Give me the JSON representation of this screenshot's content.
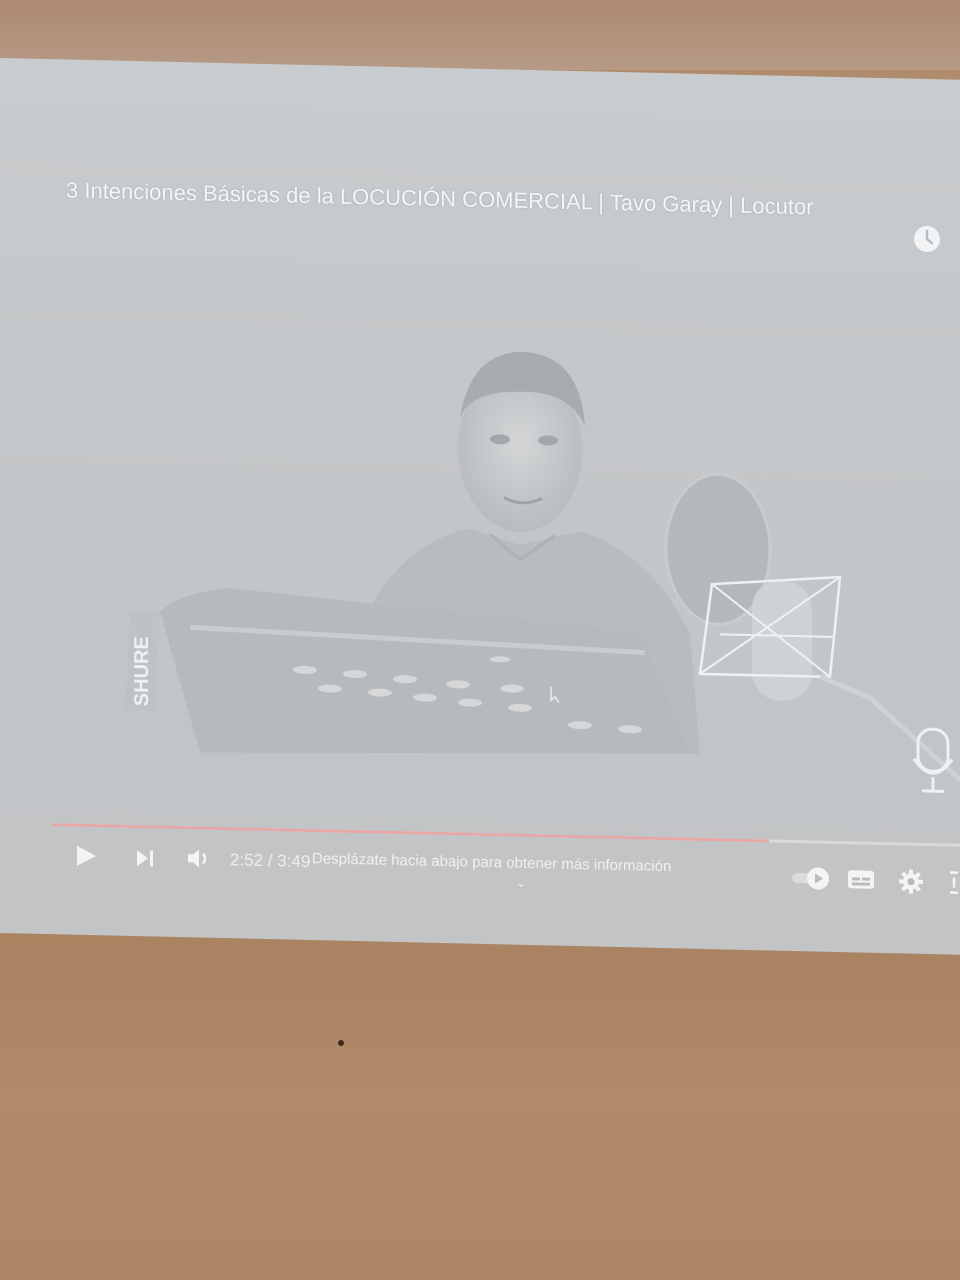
{
  "video": {
    "title": "3 Intenciones Básicas de la LOCUCIÓN COMERCIAL | Tavo Garay | Locutor",
    "watch_later_icon": "clock-icon",
    "mic_brand": "SHURE"
  },
  "player": {
    "time_display": "2:52 / 3:49",
    "progress_fraction": 0.79,
    "scroll_hint": "Desplázate hacia abajo para obtener más información",
    "icons": [
      "play-icon",
      "next-icon",
      "volume-icon",
      "autoplay-toggle-icon",
      "subtitles-icon",
      "settings-icon",
      "fullscreen-icon"
    ]
  },
  "colors": {
    "screen_bg": "#c6c9cb",
    "wall": "#b08a6a",
    "progress": "#e7a8a8",
    "text": "#f3f4f5"
  }
}
